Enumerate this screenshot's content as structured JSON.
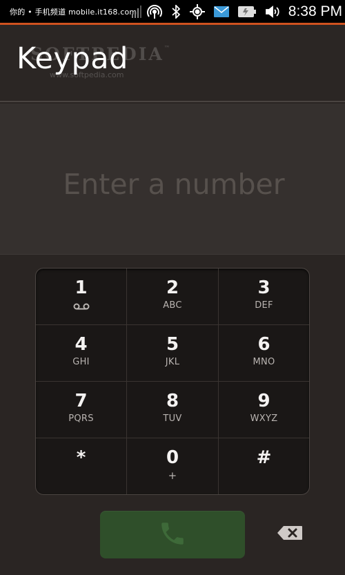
{
  "status_bar": {
    "watermark": "你的 • 手机频道 mobile.it168.com",
    "time": "8:38 PM",
    "icons": [
      "signal-icon",
      "hotspot-icon",
      "bluetooth-icon",
      "gps-icon",
      "email-icon",
      "battery-icon",
      "volume-icon"
    ]
  },
  "header": {
    "title": "Keypad",
    "watermark_logo": "SOFTPEDIA",
    "watermark_url": "www.softpedia.com"
  },
  "entry": {
    "placeholder": "Enter a number",
    "value": ""
  },
  "keypad": {
    "keys": [
      {
        "digit": "1",
        "letters": ""
      },
      {
        "digit": "2",
        "letters": "ABC"
      },
      {
        "digit": "3",
        "letters": "DEF"
      },
      {
        "digit": "4",
        "letters": "GHI"
      },
      {
        "digit": "5",
        "letters": "JKL"
      },
      {
        "digit": "6",
        "letters": "MNO"
      },
      {
        "digit": "7",
        "letters": "PQRS"
      },
      {
        "digit": "8",
        "letters": "TUV"
      },
      {
        "digit": "9",
        "letters": "WXYZ"
      },
      {
        "digit": "*",
        "letters": ""
      },
      {
        "digit": "0",
        "letters": "+"
      },
      {
        "digit": "#",
        "letters": ""
      }
    ]
  },
  "actions": {
    "call_icon": "phone-icon",
    "backspace_icon": "backspace-icon"
  },
  "colors": {
    "accent_line": "#d0521f",
    "call_button": "#2f4f2a",
    "call_icon": "#3e6a39",
    "background": "#2a2523"
  }
}
